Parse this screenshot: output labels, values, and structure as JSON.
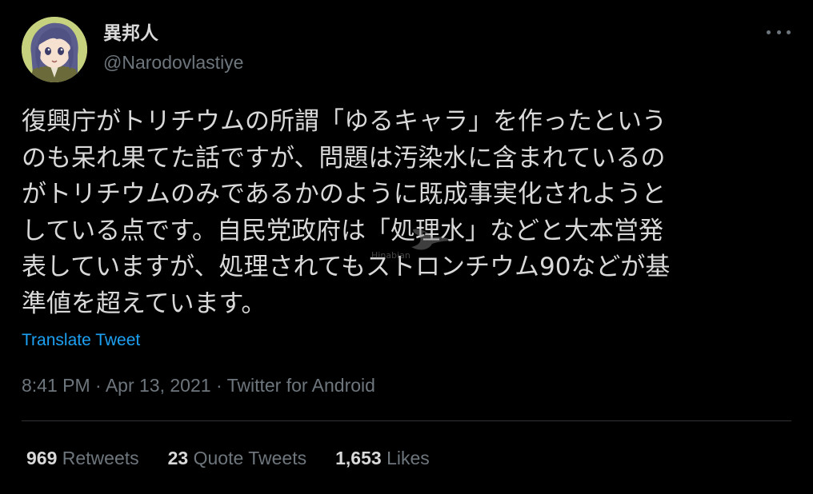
{
  "user": {
    "display_name": "異邦人",
    "handle": "@Narodovlastiye"
  },
  "tweet": {
    "lines": [
      "復興庁がトリチウムの所謂「ゆるキャラ」を作ったという",
      "のも呆れ果てた話ですが、問題は汚染水に含まれているの",
      "がトリチウムのみであるかのように既成事実化されようと",
      "している点です。自民党政府は「処理水」などと大本営発",
      "表していますが、処理されてもストロンチウム90などが基",
      "準値を超えています。"
    ],
    "translate_label": "Translate Tweet",
    "time": "8:41 PM",
    "separator": "·",
    "date": "Apr 13, 2021",
    "source": "Twitter for Android"
  },
  "stats": {
    "retweets_count": "969",
    "retweets_label": "Retweets",
    "quotes_count": "23",
    "quotes_label": "Quote Tweets",
    "likes_count": "1,653",
    "likes_label": "Likes"
  },
  "watermark": {
    "text": "Hinabian"
  },
  "icons": {
    "more": "more-horizontal-icon",
    "avatar": "avatar-image"
  },
  "colors": {
    "background": "#000000",
    "text": "#d9d9d9",
    "secondary": "#6e767d",
    "accent": "#1da1f2",
    "divider": "#2f3336"
  }
}
